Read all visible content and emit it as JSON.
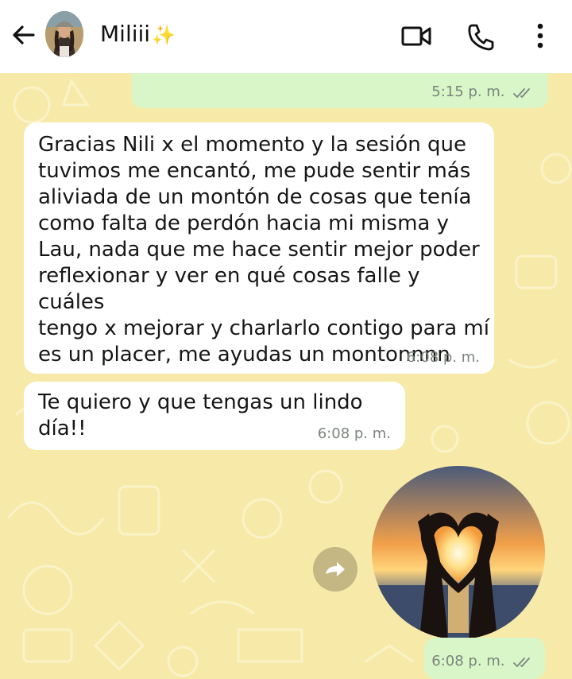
{
  "header": {
    "contact_name": "Miliii",
    "name_emoji": "✨",
    "back_icon": "arrow-left-icon",
    "video_icon": "video-call-icon",
    "call_icon": "phone-icon",
    "menu_icon": "more-vert-icon"
  },
  "messages": [
    {
      "direction": "outgoing",
      "time": "5:15 p. m.",
      "status": "read"
    },
    {
      "direction": "incoming",
      "text": "Gracias Nili x el momento y la sesión que\ntuvimos me encantó, me pude sentir más\naliviada de un montón de cosas que tenía\ncomo falta de perdón hacia mi misma y\nLau, nada que me hace sentir mejor poder\nreflexionar y ver en qué cosas falle y cuáles\ntengo x mejorar y charlarlo contigo para mí\nes un placer, me ayudas un montonnnn",
      "time": "6:08 p. m."
    },
    {
      "direction": "incoming",
      "text": "Te quiero y que tengas un lindo día!!",
      "time": "6:08 p. m."
    },
    {
      "direction": "outgoing",
      "type": "image",
      "image_desc": "heart-hands-sunset-image",
      "time": "6:08 p. m.",
      "status": "read"
    }
  ],
  "colors": {
    "chat_bg": "#f7eaa8",
    "outgoing_bubble": "#d8f6c8",
    "incoming_bubble": "#ffffff",
    "read_ticks": "#7c847c"
  }
}
